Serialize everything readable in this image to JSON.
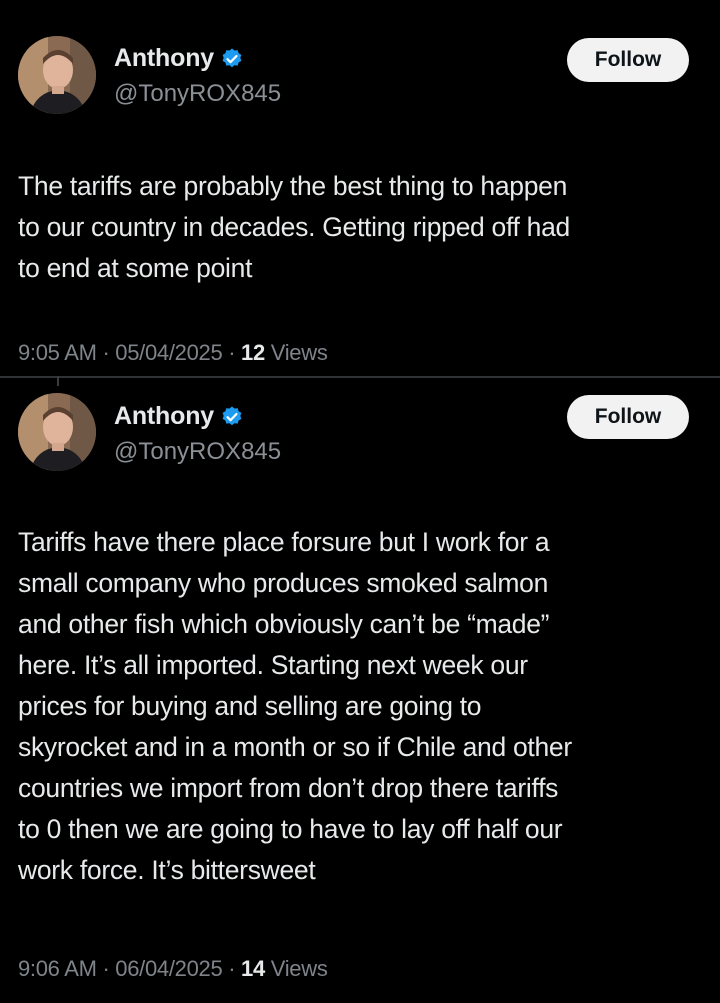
{
  "posts": [
    {
      "author": {
        "display_name": "Anthony",
        "handle": "@TonyROX845",
        "verified": true
      },
      "follow_label": "Follow",
      "text_lines": [
        "The tariffs are probably the best thing to happen",
        "to our country in decades. Getting ripped off had",
        "to end at some point"
      ],
      "time": "9:05 AM",
      "date": "05/04/2025",
      "views_count": "12",
      "views_label": "Views"
    },
    {
      "author": {
        "display_name": "Anthony",
        "handle": "@TonyROX845",
        "verified": true
      },
      "follow_label": "Follow",
      "text_lines": [
        "Tariffs have there place forsure but I work for a",
        "small company who produces smoked salmon",
        "and other fish which obviously can’t be “made”",
        "here. It’s all imported. Starting next week our",
        "prices for buying and selling are going to",
        "skyrocket and in a month or so if Chile and other",
        "countries we import from don’t drop there tariffs",
        "to 0 then we are going to have to lay off half our",
        "work force. It’s bittersweet"
      ],
      "time": "9:06 AM",
      "date": "06/04/2025",
      "views_count": "14",
      "views_label": "Views"
    }
  ],
  "separator": "·",
  "icons": {
    "verified": "verified-badge-icon",
    "avatar": "profile-photo"
  },
  "colors": {
    "background": "#000000",
    "text": "#e7e9ea",
    "secondary_text": "#8b9096",
    "verified_blue": "#1d9bf0",
    "follow_bg": "#f2f2f2"
  }
}
